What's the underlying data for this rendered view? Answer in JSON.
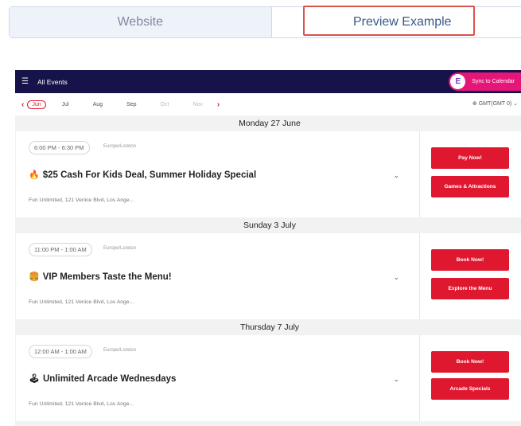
{
  "tabs": {
    "website": "Website",
    "preview": "Preview Example"
  },
  "topbar": {
    "all_events": "All Events",
    "sync_label": "Sync to Calendar",
    "logo_letter": "E"
  },
  "months": {
    "prev_arrow": "‹",
    "next_arrow": "›",
    "items": [
      "Jun",
      "Jul",
      "Aug",
      "Sep",
      "Oct",
      "Nov"
    ],
    "timezone": "GMT(GMT 0)"
  },
  "events": [
    {
      "date": "Monday 27 June",
      "time": "6:00 PM - 6:30 PM",
      "tz": "Europe/London",
      "emoji": "🔥",
      "title": "$25 Cash For Kids Deal, Summer Holiday Special",
      "venue": "Fun Unlimited, 121 Venice Blvd, Los Ange...",
      "buttons": [
        "Pay Now!",
        "Games & Attractions"
      ]
    },
    {
      "date": "Sunday 3 July",
      "time": "11:00 PM - 1:00 AM",
      "tz": "Europe/London",
      "emoji": "🍔",
      "title": "VIP Members Taste the Menu!",
      "venue": "Fun Unlimited, 121 Venice Blvd, Los Ange...",
      "buttons": [
        "Book Now!",
        "Explore the Menu"
      ]
    },
    {
      "date": "Thursday 7 July",
      "time": "12:00 AM - 1:00 AM",
      "tz": "Europe/London",
      "emoji": "🕹",
      "title": "Unlimited Arcade Wednesdays",
      "venue": "Fun Unlimited, 121 Venice Blvd, Los Ange...",
      "buttons": [
        "Book Now!",
        "Arcade Specials"
      ]
    }
  ],
  "colors": {
    "accent_red": "#e0182f",
    "topbar_navy": "#15134a",
    "sync_pink": "#e6157a",
    "highlight": "#d9534f"
  }
}
